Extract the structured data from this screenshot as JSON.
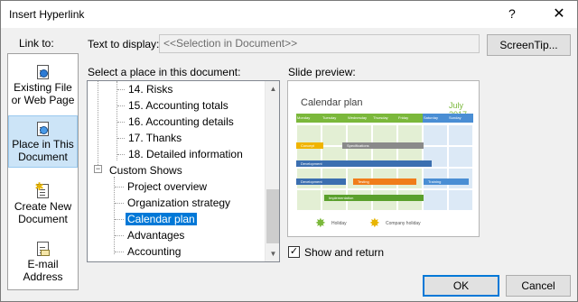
{
  "window": {
    "title": "Insert Hyperlink",
    "help_glyph": "?",
    "close_glyph": "✕"
  },
  "link_to": {
    "label": "Link to:",
    "items": [
      {
        "line1": "Existing File",
        "line2": "or Web Page",
        "icon": "web-page-icon"
      },
      {
        "line1": "Place in This",
        "line2": "Document",
        "icon": "place-in-document-icon"
      },
      {
        "line1": "Create New",
        "line2": "Document",
        "icon": "new-document-icon"
      },
      {
        "line1": "E-mail",
        "line2": "Address",
        "icon": "email-icon"
      }
    ]
  },
  "text_to_display": {
    "label": "Text to display:",
    "value": "<<Selection in Document>>"
  },
  "buttons": {
    "screentip": "ScreenTip...",
    "ok": "OK",
    "cancel": "Cancel"
  },
  "place_list": {
    "label": "Select a place in this document:",
    "items": [
      "14. Risks",
      "15. Accounting totals",
      "16. Accounting details",
      "17. Thanks",
      "18. Detailed information",
      "Custom Shows",
      "Project overview",
      "Organization strategy",
      "Calendar plan",
      "Advantages",
      "Accounting"
    ],
    "selected": "Calendar plan"
  },
  "slide_preview": {
    "label": "Slide preview:",
    "title": "Calendar plan",
    "month": "July 2017",
    "days": [
      "Monday",
      "Tuesday",
      "Wednesday",
      "Thursday",
      "Friday",
      "Saturday",
      "Sunday"
    ],
    "bars": [
      "Concept",
      "Specifications",
      "Development",
      "Development",
      "Testing",
      "Training",
      "Implementation"
    ],
    "legend_holiday": "Holiday",
    "legend_company_holiday": "Company holiday",
    "colors": {
      "weekday_header": "#7bb83b",
      "weekend_header": "#4a8ed4",
      "weekday_cell": "#e3efd4",
      "weekend_cell": "#dce9f6"
    }
  },
  "show_and_return": {
    "label": "Show and return",
    "checked": true,
    "check_glyph": "✓"
  }
}
